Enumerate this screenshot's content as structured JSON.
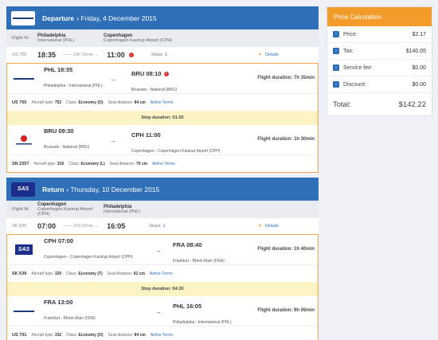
{
  "departure": {
    "airline_logo": "us-airways-logo",
    "title_bold": "Departure",
    "title_rest": "› Friday, 4 December 2015",
    "flight_nr_label": "Flight Nr.",
    "from_city": "Philadelphia",
    "from_airport": "International (PHL)",
    "to_city": "Copenhagen",
    "to_airport": "Copenhagen Kastrup Airport (CPH)",
    "summary": {
      "flight": "US 750",
      "dep": "18:35",
      "duration": "—— 10h 35min →",
      "arr": "11:00",
      "stops_label": "Stops:",
      "stops": "1",
      "details": "Details"
    },
    "segments": [
      {
        "logo": "us-airways-logo",
        "from_time": "PHL 18:35",
        "from_name": "Philadelphia - International (PHL)",
        "to_time": "BRU 08:10",
        "to_name": "Brussels - National (BRU)",
        "duration": "Flight duration: 7h 35min",
        "flight": "US 750",
        "aircraft_label": "Aircraft type:",
        "aircraft": "752",
        "class_label": "Class:",
        "class": "Economy (O)",
        "seat_label": "Seat distance:",
        "seat": "84 cm",
        "terms": "Airline Terms"
      },
      {
        "logo": "brussels-airlines-logo",
        "from_time": "BRU 09:30",
        "from_name": "Brussels - National (BRU)",
        "to_time": "CPH 11:00",
        "to_name": "Copenhagen - Copenhagen Kastrup Airport (CPH)",
        "duration": "Flight duration: 1h 30min",
        "flight": "SN 2257",
        "aircraft_label": "Aircraft type:",
        "aircraft": "319",
        "class_label": "Class:",
        "class": "Economy (L)",
        "seat_label": "Seat distance:",
        "seat": "79 cm",
        "terms": "Airline Terms"
      }
    ],
    "stop": "Stop duration: 01:20"
  },
  "return": {
    "airline_logo": "sas-logo",
    "title_bold": "Return",
    "title_rest": "› Thursday, 10 December 2015",
    "flight_nr_label": "Flight Nr.",
    "from_city": "Copenhagen",
    "from_airport": "Copenhagen Kastrup Airport (CPH)",
    "to_city": "Philadelphia",
    "to_airport": "International (PHL)",
    "summary": {
      "flight": "SK 639",
      "dep": "07:00",
      "duration": "—— 15h 05min →",
      "arr": "16:05",
      "stops_label": "Stops:",
      "stops": "1",
      "details": "Details"
    },
    "segments": [
      {
        "logo": "sas-logo",
        "from_time": "CPH 07:00",
        "from_name": "Copenhagen - Copenhagen Kastrup Airport (CPH)",
        "to_time": "FRA 08:40",
        "to_name": "Frankfurt - Rhein-Main (FRA)",
        "duration": "Flight duration: 1h 40min",
        "flight": "SK 639",
        "aircraft_label": "Aircraft type:",
        "aircraft": "320",
        "class_label": "Class:",
        "class": "Economy (T)",
        "seat_label": "Seat distance:",
        "seat": "81 cm",
        "terms": "Airline Terms"
      },
      {
        "logo": "us-airways-logo",
        "from_time": "FRA 13:00",
        "from_name": "Frankfurt - Rhein-Main (FRA)",
        "to_time": "PHL 16:05",
        "to_name": "Philadelphia - International (PHL)",
        "duration": "Flight duration: 9h 05min",
        "flight": "US 701",
        "aircraft_label": "Aircraft type:",
        "aircraft": "332",
        "class_label": "Class:",
        "class": "Economy (O)",
        "seat_label": "Seat distance:",
        "seat": "84 cm",
        "terms": "Airline Terms"
      }
    ],
    "stop": "Stop duration: 04:20"
  },
  "price": {
    "title": "Price Calculation",
    "rows": [
      {
        "label": "Price:",
        "value": "$2.17"
      },
      {
        "label": "Tax:",
        "value": "$140.05"
      },
      {
        "label": "Service fee:",
        "value": "$0.00"
      },
      {
        "label": "Discount:",
        "value": "$0.00"
      }
    ],
    "total_label": "Total:",
    "total_value": "$142.22"
  },
  "colors": {
    "header_blue": "#2e6fb8",
    "accent_orange": "#f39c2a",
    "stop_yellow": "#fbf3c4"
  }
}
